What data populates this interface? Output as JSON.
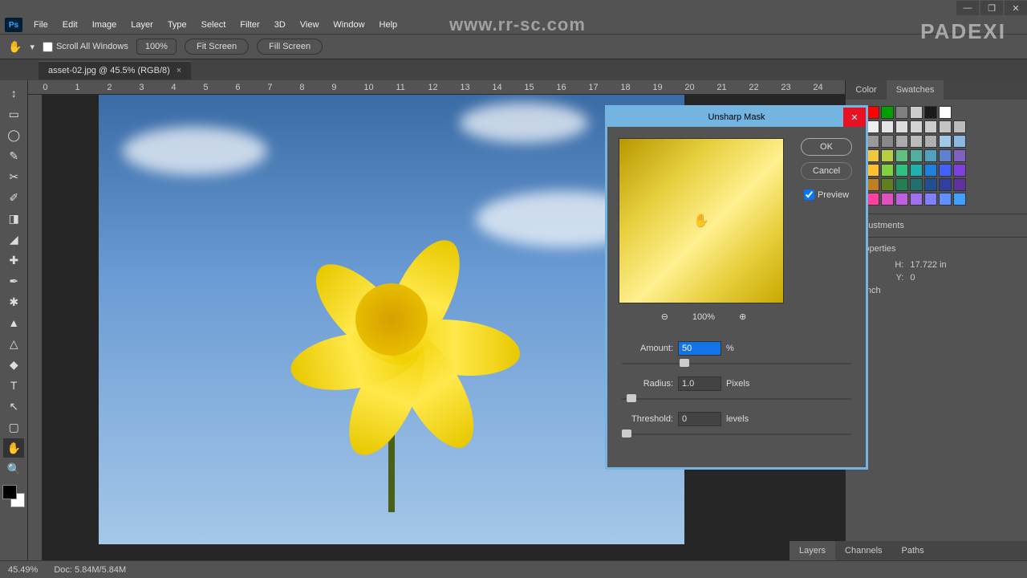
{
  "window": {
    "minimize": "—",
    "maximize": "❐",
    "close": "✕"
  },
  "menubar": [
    "File",
    "Edit",
    "Image",
    "Layer",
    "Type",
    "Select",
    "Filter",
    "3D",
    "View",
    "Window",
    "Help"
  ],
  "optionsbar": {
    "scroll_all": "Scroll All Windows",
    "zoom": "100%",
    "fit": "Fit Screen",
    "fill": "Fill Screen"
  },
  "tab": {
    "title": "asset-02.jpg @ 45.5% (RGB/8)",
    "close": "×"
  },
  "tools": [
    "↕",
    "▭",
    "◯",
    "✎",
    "✂",
    "✐",
    "◨",
    "◢",
    "✚",
    "✒",
    "✱",
    "▲",
    "△",
    "◆",
    "T",
    "↖",
    "▢",
    "✋",
    "🔍"
  ],
  "ruler_h": [
    "0",
    "1",
    "2",
    "3",
    "4",
    "5",
    "6",
    "7",
    "8",
    "9",
    "10",
    "11",
    "12",
    "13",
    "14",
    "15",
    "16",
    "17",
    "18",
    "19",
    "20",
    "21",
    "22",
    "23",
    "24"
  ],
  "panels": {
    "color_tab": "Color",
    "swatches_tab": "Swatches",
    "adjustments": "Adjustments",
    "properties": "Properties",
    "h_label": "H:",
    "h_value": "17.722 in",
    "y_label": "Y:",
    "y_value": "0",
    "res_unit": "ls/inch",
    "layers": "Layers",
    "channels": "Channels",
    "paths": "Paths"
  },
  "swatch_colors": [
    [
      "#000000",
      "#ff0000",
      "#00a000",
      "#808080",
      "#cccccc",
      "#1a1a1a",
      "#ffffff"
    ],
    [
      "#ffffff",
      "#eeeeee",
      "#e5e5e5",
      "#dddddd",
      "#d4d4d4",
      "#cccccc",
      "#c4c4c4",
      "#bbbbbb"
    ],
    [
      "#666666",
      "#999999",
      "#888888",
      "#aaaaaa",
      "#bbbbbb",
      "#b0b0b0",
      "#a0c8e8",
      "#8ab8e0"
    ],
    [
      "#e0a060",
      "#f0c840",
      "#b8d040",
      "#60c080",
      "#50b0a0",
      "#50a0c0",
      "#6080d0",
      "#8060c0"
    ],
    [
      "#ff8040",
      "#ffc030",
      "#80d040",
      "#30c080",
      "#20b0b0",
      "#2080e0",
      "#4060ff",
      "#8040e0"
    ],
    [
      "#c04020",
      "#c08020",
      "#608020",
      "#208050",
      "#207070",
      "#205090",
      "#3040a0",
      "#6030a0"
    ],
    [
      "#ff6080",
      "#ff40a0",
      "#e050c0",
      "#c060e0",
      "#a070f0",
      "#8080ff",
      "#6090ff",
      "#40a0ff"
    ]
  ],
  "statusbar": {
    "zoom": "45.49%",
    "doc": "Doc: 5.84M/5.84M"
  },
  "dialog": {
    "title": "Unsharp Mask",
    "ok": "OK",
    "cancel": "Cancel",
    "preview": "Preview",
    "zoom": "100%",
    "amount_label": "Amount:",
    "amount_value": "50",
    "amount_unit": "%",
    "radius_label": "Radius:",
    "radius_value": "1.0",
    "radius_unit": "Pixels",
    "threshold_label": "Threshold:",
    "threshold_value": "0",
    "threshold_unit": "levels",
    "hand_cursor": "✋"
  },
  "watermark": "www.rr-sc.com",
  "brand": "PADEXI"
}
